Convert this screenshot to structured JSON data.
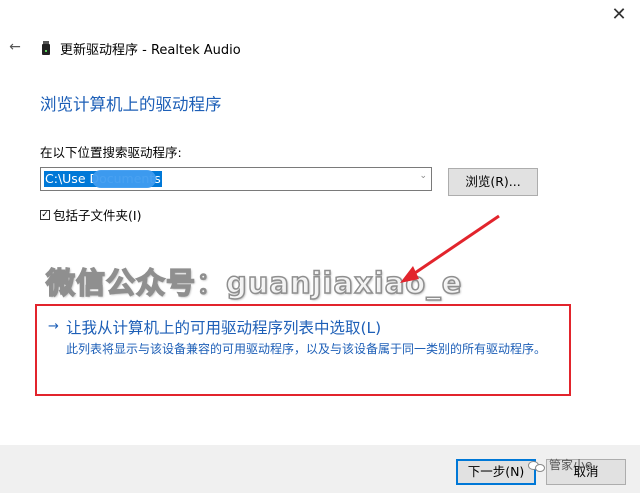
{
  "window": {
    "title": "更新驱动程序 - Realtek Audio",
    "close_glyph": "✕",
    "back_glyph": "←"
  },
  "page": {
    "heading": "浏览计算机上的驱动程序"
  },
  "search": {
    "label": "在以下位置搜索驱动程序:",
    "path_value": "C:\\Use                  Documents",
    "browse_label": "浏览(R)..."
  },
  "subfolders": {
    "checked": true,
    "check_glyph": "☑",
    "label": "包括子文件夹(I)"
  },
  "watermark": {
    "text": "微信公众号：guanjiaxiao_e"
  },
  "pick_option": {
    "arrow_glyph": "→",
    "title": "让我从计算机上的可用驱动程序列表中选取(L)",
    "description": "此列表将显示与该设备兼容的可用驱动程序，以及与该设备属于同一类别的所有驱动程序。"
  },
  "footer": {
    "next_label": "下一步(N)",
    "cancel_label": "取消",
    "badge_text": "管家小e"
  },
  "colors": {
    "accent_blue": "#1d5fb7",
    "annotation_red": "#e2242c",
    "selection_blue": "#0078d7"
  }
}
